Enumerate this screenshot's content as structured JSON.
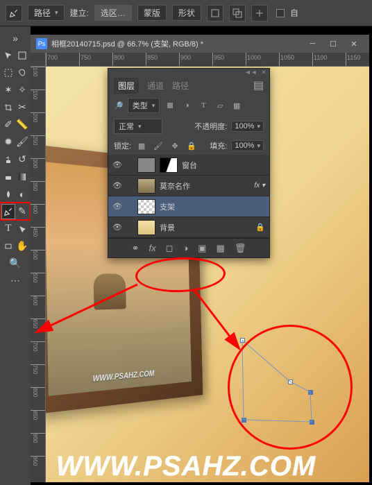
{
  "options_bar": {
    "mode": "路径",
    "create_label": "建立:",
    "btn_selection": "选区…",
    "btn_mask": "蒙版",
    "btn_shape": "形状",
    "auto_label": "自"
  },
  "document": {
    "icon": "Ps",
    "title": "相框20140715.psd @ 66.7% (支架, RGB/8) *"
  },
  "ruler_h": [
    "700",
    "750",
    "800",
    "850",
    "900",
    "950",
    "1000",
    "1050",
    "1100",
    "1150"
  ],
  "ruler_v": [
    "100",
    "150",
    "200",
    "250",
    "300",
    "350",
    "400",
    "450",
    "500",
    "550",
    "600",
    "650",
    "700",
    "750",
    "800",
    "850",
    "900",
    "950"
  ],
  "canvas_watermark": "WWW.PSAHZ.COM",
  "panel": {
    "tabs": [
      "图层",
      "通道",
      "路径"
    ],
    "active_tab": 0,
    "filter_label": "类型",
    "blend_mode": "正常",
    "opacity_label": "不透明度:",
    "opacity_value": "100%",
    "lock_label": "锁定:",
    "fill_label": "填充:",
    "fill_value": "100%",
    "layers": [
      {
        "name": "窗台",
        "visible": true,
        "type": "gradient"
      },
      {
        "name": "莫奈名作",
        "visible": true,
        "type": "monet",
        "fx": true
      },
      {
        "name": "支架",
        "visible": true,
        "type": "checker",
        "selected": true
      },
      {
        "name": "背景",
        "visible": true,
        "type": "bg",
        "locked": true
      }
    ],
    "footer_icons": [
      "link",
      "fx",
      "mask",
      "adjust",
      "group",
      "new",
      "trash"
    ]
  },
  "big_watermark": "WWW.PSAHZ.COM"
}
